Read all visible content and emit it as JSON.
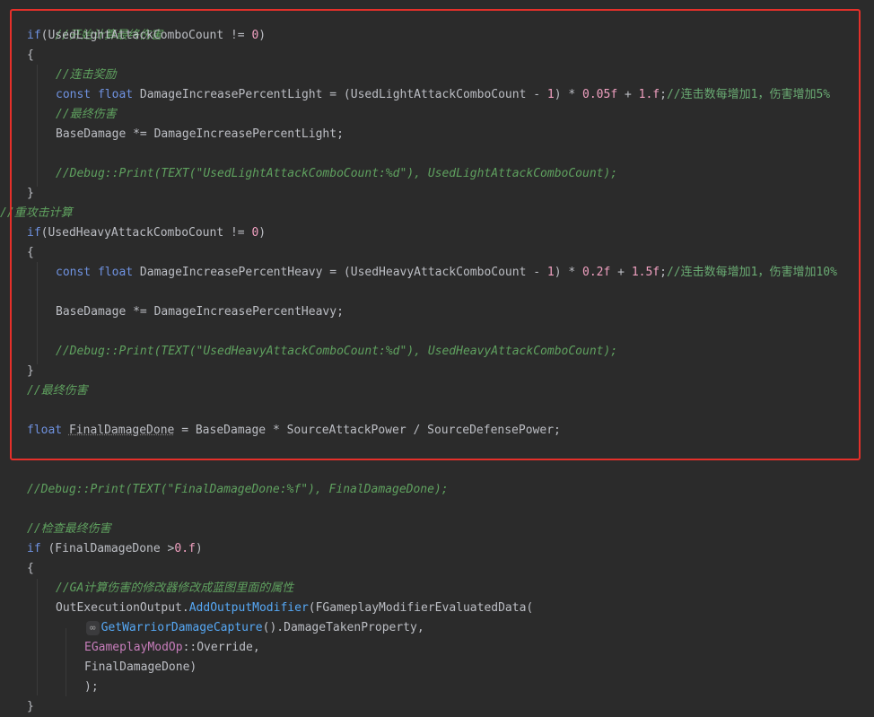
{
  "code": {
    "l0_comment": "//开始计算最终伤害",
    "l1_if": "if",
    "l1_cond": "(UsedLightAttackComboCount != ",
    "l1_zero": "0",
    "l1_close": ")",
    "l2_brace": "{",
    "l3_comment": "//连击奖励",
    "l4_const": "const",
    "l4_float": "float",
    "l4_a": " DamageIncreasePercentLight = (UsedLightAttackComboCount - ",
    "l4_one": "1",
    "l4_b": ") * ",
    "l4_n1": "0.05f",
    "l4_c": " + ",
    "l4_n2": "1.f",
    "l4_d": ";",
    "l4_comment": "//连击数每增加1，伤害增加5%",
    "l5_comment": "//最终伤害",
    "l6": "BaseDamage *= DamageIncreasePercentLight;",
    "l8_comment": "//Debug::Print(TEXT(\"UsedLightAttackComboCount:%d\"), UsedLightAttackComboCount);",
    "l9_brace": "}",
    "l10_comment": "//重攻击计算",
    "l11_if": "if",
    "l11_cond": "(UsedHeavyAttackComboCount != ",
    "l11_zero": "0",
    "l11_close": ")",
    "l12_brace": "{",
    "l13_const": "const",
    "l13_float": "float",
    "l13_a": " DamageIncreasePercentHeavy = (UsedHeavyAttackComboCount - ",
    "l13_one": "1",
    "l13_b": ") * ",
    "l13_n1": "0.2f",
    "l13_c": " + ",
    "l13_n2": "1.5f",
    "l13_d": ";",
    "l13_comment": "//连击数每增加1，伤害增加10%",
    "l15": "BaseDamage *= DamageIncreasePercentHeavy;",
    "l17_comment": "//Debug::Print(TEXT(\"UsedHeavyAttackComboCount:%d\"), UsedHeavyAttackComboCount);",
    "l18_brace": "}",
    "l19_comment": "//最终伤害",
    "l21_float": "float",
    "l21_a": " ",
    "l21_var": "FinalDamageDone",
    "l21_b": " = BaseDamage * SourceAttackPower / SourceDefensePower;",
    "l24_comment": "//Debug::Print(TEXT(\"FinalDamageDone:%f\"), FinalDamageDone);",
    "l26_comment": "//检查最终伤害",
    "l27_if": "if",
    "l27_a": " (FinalDamageDone >",
    "l27_num": "0.f",
    "l27_b": ")",
    "l28_brace": "{",
    "l29_comment": "//GA计算伤害的修改器修改成蓝图里面的属性",
    "l30_a": "OutExecutionOutput.",
    "l30_fn": "AddOutputModifier",
    "l30_b": "(FGameplayModifierEvaluatedData(",
    "l31_hint": "∞",
    "l31_fn": "GetWarriorDamageCapture",
    "l31_b": "().DamageTakenProperty,",
    "l32_ty": "EGameplayModOp",
    "l32_b": "::Override,",
    "l33": "FinalDamageDone)",
    "l34": ");",
    "l35_brace": "}"
  },
  "colors": {
    "background": "#2b2b2b",
    "selection_border": "#e5302a",
    "keyword": "#6f92e0",
    "number": "#f0a0c0",
    "comment": "#5fa15f",
    "function": "#56a8f5"
  }
}
